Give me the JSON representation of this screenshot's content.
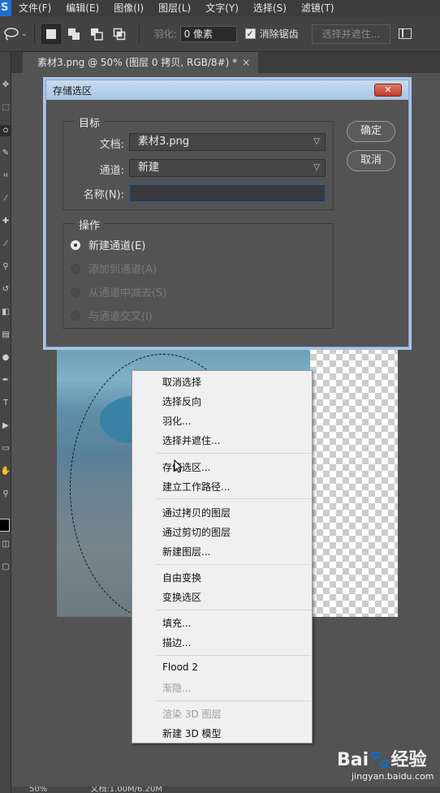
{
  "menubar": {
    "logo": "S",
    "items": [
      "文件(F)",
      "编辑(E)",
      "图像(I)",
      "图层(L)",
      "文字(Y)",
      "选择(S)",
      "滤镜(T)"
    ]
  },
  "options": {
    "lasso_icon": "lasso-icon",
    "feather_label": "羽化:",
    "feather_value": "0 像素",
    "antialias_label": "消除锯齿",
    "antialias_checked": true,
    "select_mask_button": "选择并遮住..."
  },
  "document": {
    "tab_title": "素材3.png @ 50% (图层 0 拷贝, RGB/8#) *",
    "close_glyph": "×"
  },
  "dialog": {
    "title": "存储选区",
    "close_glyph": "✕",
    "target_group": "目标",
    "document_label": "文档:",
    "document_value": "素材3.png",
    "channel_label": "通道:",
    "channel_value": "新建",
    "name_label": "名称(N):",
    "name_value": "",
    "ok_button": "确定",
    "cancel_button": "取消",
    "operation_group": "操作",
    "operations": [
      {
        "label": "新建通道(E)",
        "selected": true,
        "enabled": true
      },
      {
        "label": "添加到通道(A)",
        "selected": false,
        "enabled": false
      },
      {
        "label": "从通道中减去(S)",
        "selected": false,
        "enabled": false
      },
      {
        "label": "与通道交叉(I)",
        "selected": false,
        "enabled": false
      }
    ]
  },
  "context_menu": {
    "items": [
      {
        "label": "取消选择",
        "enabled": true
      },
      {
        "label": "选择反向",
        "enabled": true
      },
      {
        "label": "羽化...",
        "enabled": true
      },
      {
        "label": "选择并遮住...",
        "enabled": true
      },
      {
        "label": "存储选区...",
        "enabled": true
      },
      {
        "label": "建立工作路径...",
        "enabled": true
      },
      {
        "label": "通过拷贝的图层",
        "enabled": true
      },
      {
        "label": "通过剪切的图层",
        "enabled": true
      },
      {
        "label": "新建图层...",
        "enabled": true
      },
      {
        "label": "自由变换",
        "enabled": true
      },
      {
        "label": "变换选区",
        "enabled": true
      },
      {
        "label": "填充...",
        "enabled": true
      },
      {
        "label": "描边...",
        "enabled": true
      },
      {
        "label": "Flood 2",
        "enabled": true
      },
      {
        "label": "渐隐...",
        "enabled": false
      },
      {
        "label": "渲染 3D 图层",
        "enabled": false
      },
      {
        "label": "新建 3D 模型",
        "enabled": true
      }
    ]
  },
  "statusbar": {
    "zoom": "50%",
    "doc_info": "文档:1.00M/6.20M"
  },
  "watermark": {
    "logo": "Bai🐾经验",
    "url": "jingyan.baidu.com"
  }
}
